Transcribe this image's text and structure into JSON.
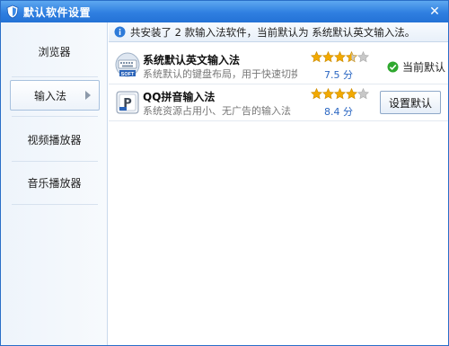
{
  "window": {
    "title": "默认软件设置",
    "close_glyph": "✕"
  },
  "sidebar": {
    "items": [
      {
        "label": "浏览器",
        "active": false
      },
      {
        "label": "输入法",
        "active": true
      },
      {
        "label": "视频播放器",
        "active": false
      },
      {
        "label": "音乐播放器",
        "active": false
      }
    ]
  },
  "info": {
    "text_before": "共安装了",
    "count": "2",
    "text_middle": "款输入法软件，当前默认为",
    "current_default": "系统默认英文输入法。"
  },
  "apps": [
    {
      "name": "系统默认英文输入法",
      "description": "系统默认的键盘布局，用于快速切换到输...",
      "rating": 3.5,
      "score_text": "7.5 分",
      "status_label": "当前默认",
      "icon": "soft-keyboard-icon"
    },
    {
      "name": "QQ拼音输入法",
      "description": "系统资源占用小、无广告的输入法",
      "rating": 4,
      "score_text": "8.4 分",
      "button_label": "设置默认",
      "icon": "qq-pinyin-icon"
    }
  ],
  "colors": {
    "titlebar": "#2f7fe0",
    "star_filled": "#f2a900",
    "star_empty": "#c8c8c8",
    "score_text": "#2a66c2",
    "check_green": "#2fa82f"
  }
}
